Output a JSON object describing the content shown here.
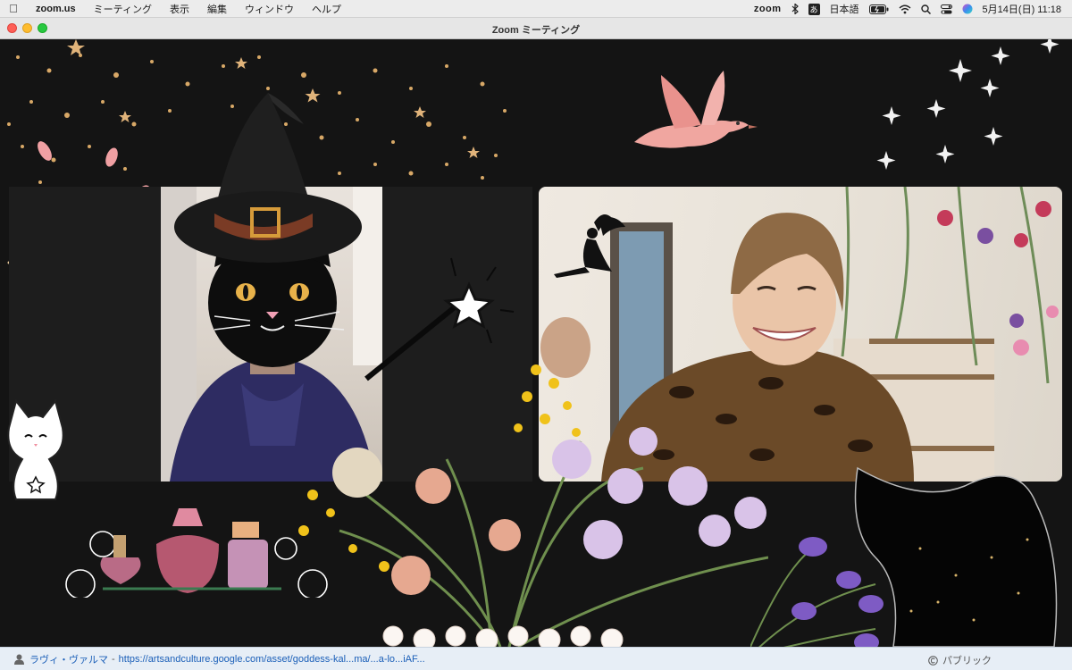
{
  "menubar": {
    "app_name": "zoom.us",
    "items": [
      "ミーティング",
      "表示",
      "編集",
      "ウィンドウ",
      "ヘルプ"
    ],
    "zoom_label": "zoom",
    "ime_symbol": "あ",
    "ime_label": "日本語",
    "datetime": "5月14日(日)  11:18"
  },
  "window": {
    "title": "Zoom ミーティング"
  },
  "credit": {
    "name": "ラヴィ・ヴァルマ",
    "separator": "-",
    "url": "https://artsandculture.google.com/asset/goddess-kal...ma/...a-lo...iAF...",
    "right_text": "パブリック"
  }
}
